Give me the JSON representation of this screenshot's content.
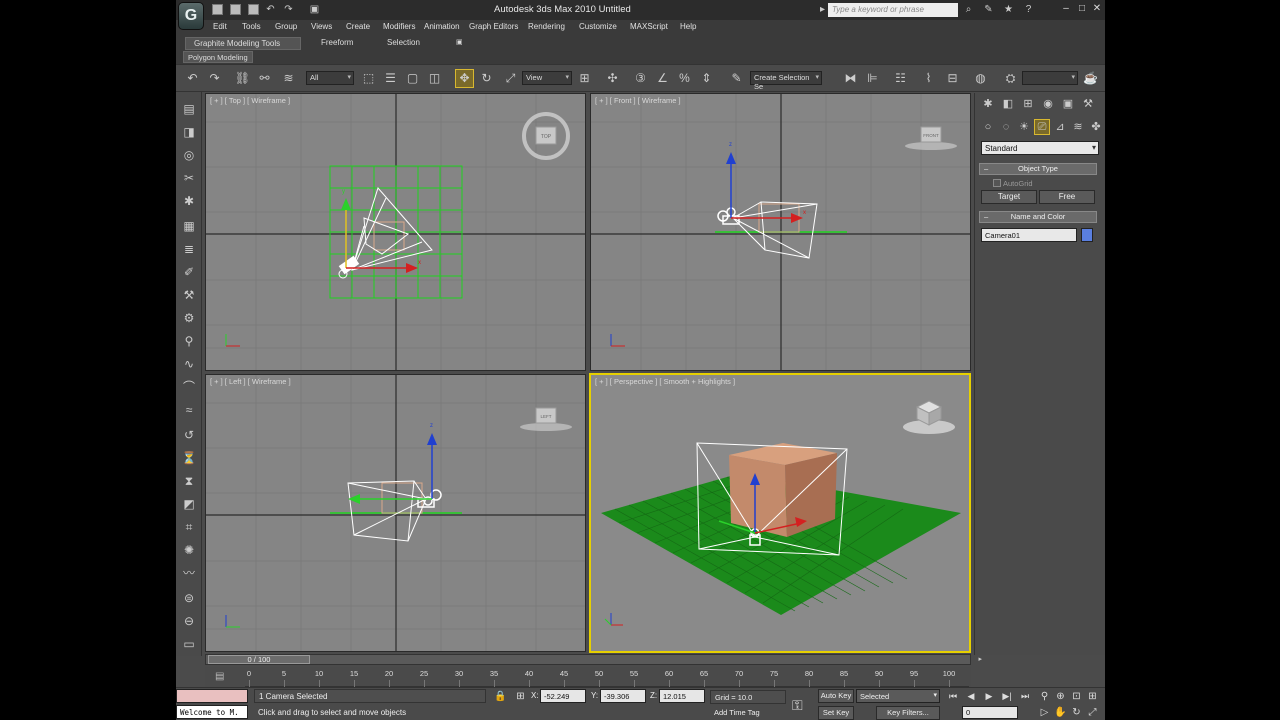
{
  "titlebar": {
    "logo": "G",
    "app_title": "Autodesk 3ds Max  2010      Untitled",
    "search_placeholder": "Type a keyword or phrase"
  },
  "menu": [
    "Edit",
    "Tools",
    "Group",
    "Views",
    "Create",
    "Modifiers",
    "Animation",
    "Graph Editors",
    "Rendering",
    "Customize",
    "MAXScript",
    "Help"
  ],
  "ribbon": {
    "tabs": [
      "Graphite Modeling Tools",
      "Freeform",
      "Selection"
    ],
    "panel": "Polygon Modeling"
  },
  "toolbar": {
    "filter_value": "All",
    "refcoord_value": "View",
    "named_selection_placeholder": "Create Selection Se"
  },
  "viewports": {
    "top": "[ + ] [ Top ] [ Wireframe ]",
    "front": "[ + ] [ Front ] [ Wireframe ]",
    "left": "[ + ] [ Left ] [ Wireframe ]",
    "perspective": "[ + ] [ Perspective ] [ Smooth + Highlights ]",
    "viewcube_top": "TOP",
    "viewcube_front": "FRONT",
    "viewcube_left": "LEFT"
  },
  "command_panel": {
    "category": "Standard",
    "object_type_header": "Object Type",
    "autogrid_label": "AutoGrid",
    "target_button": "Target",
    "free_button": "Free",
    "name_color_header": "Name and Color",
    "object_name": "Camera01",
    "object_color": "#5a7fe0"
  },
  "timeline": {
    "frame_readout": "0 / 100",
    "ruler_labels": [
      "0",
      "5",
      "10",
      "15",
      "20",
      "25",
      "30",
      "35",
      "40",
      "45",
      "50",
      "55",
      "60",
      "65",
      "70",
      "75",
      "80",
      "85",
      "90",
      "95",
      "100"
    ]
  },
  "status": {
    "maxscript_text": "Welcome to M.",
    "selection": "1 Camera Selected",
    "prompt": "Click and drag to select and move objects",
    "x_label": "X:",
    "x_value": "-52.249",
    "y_label": "Y:",
    "y_value": "-39.306",
    "z_label": "Z:",
    "z_value": "12.015",
    "grid": "Grid = 10.0",
    "add_time_tag": "Add Time Tag",
    "auto_key": "Auto Key",
    "set_key": "Set Key",
    "selected_option": "Selected",
    "key_filters": "Key Filters...",
    "current_frame": "0"
  },
  "colors": {
    "accent_active_viewport": "#e6d000",
    "grid_plane": "#1d8a1d",
    "box_object": "#c38a6b",
    "camera_wire": "#ffffff",
    "selection_green": "#1fd21f"
  }
}
